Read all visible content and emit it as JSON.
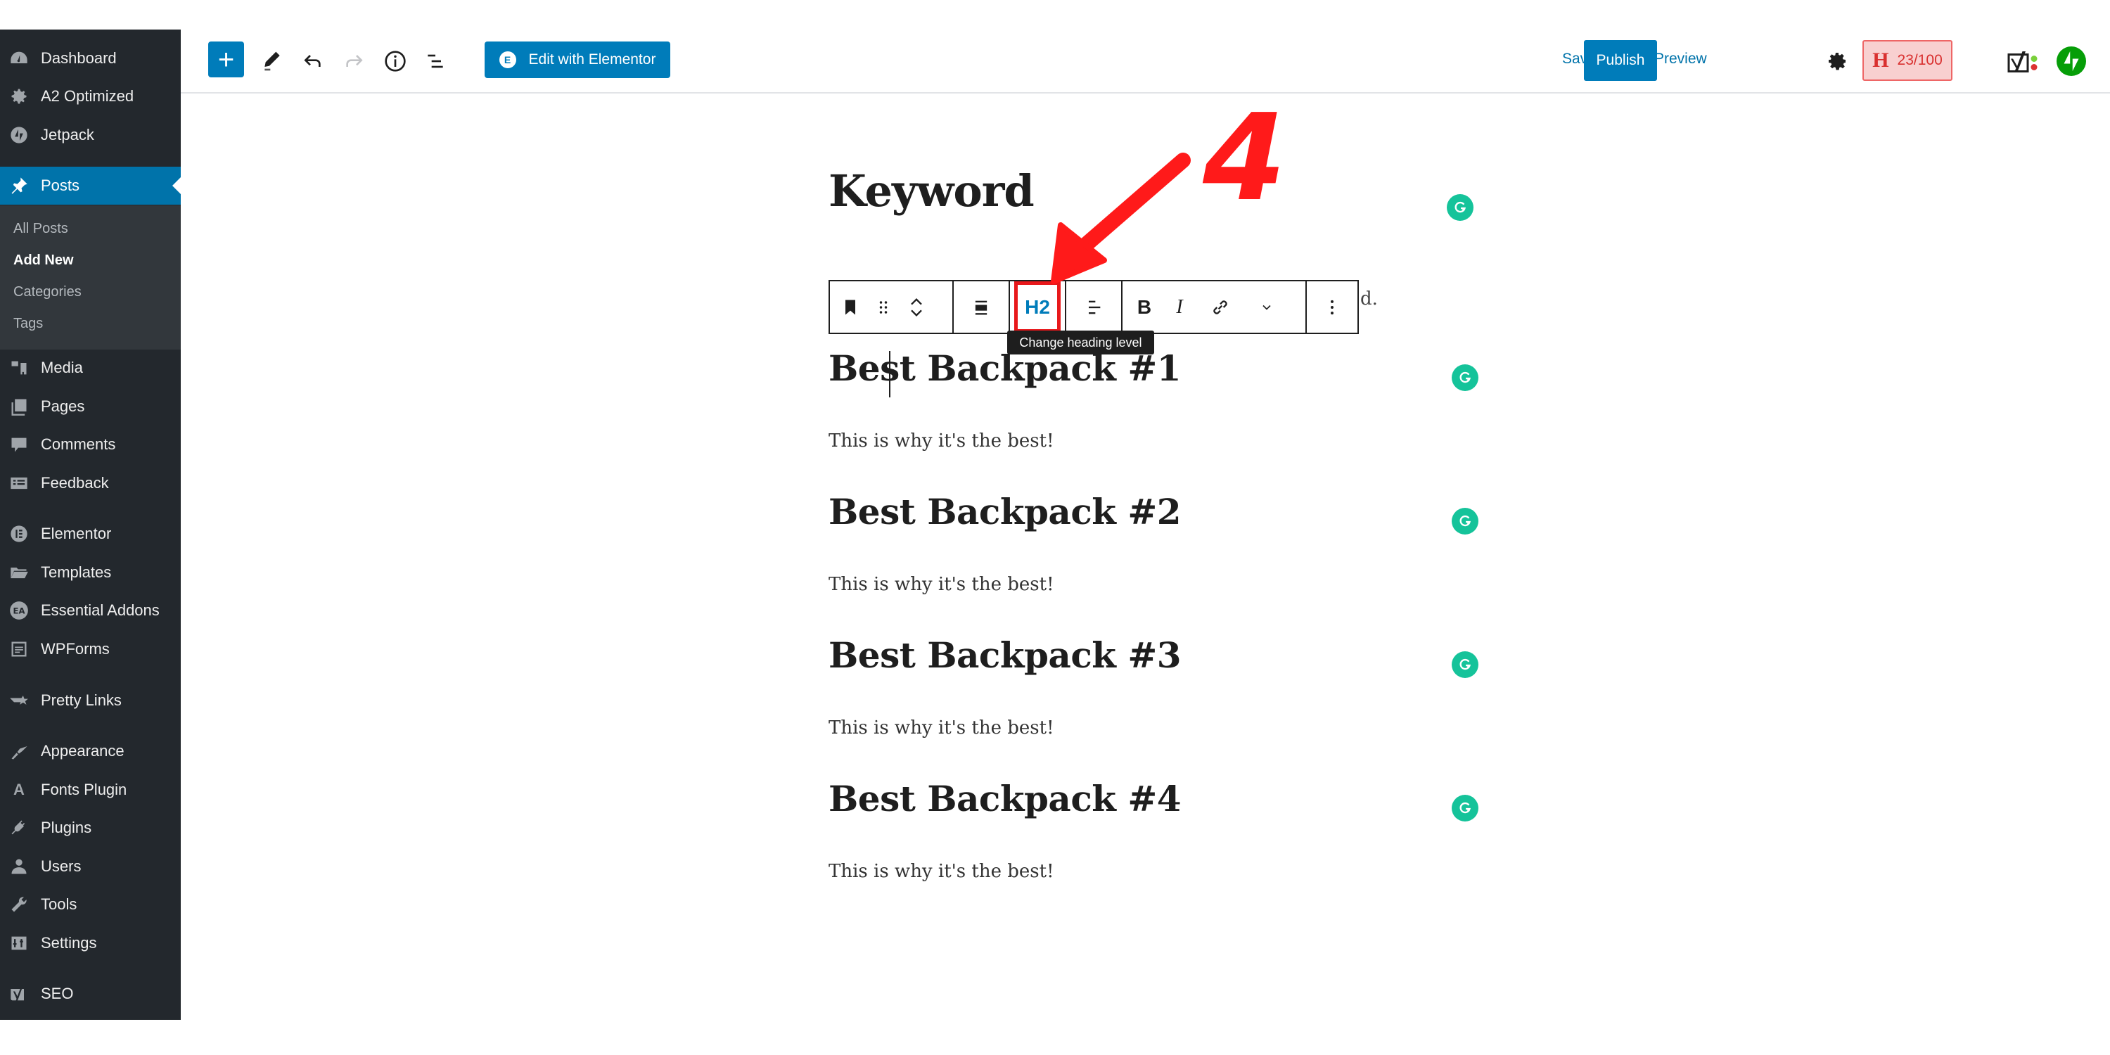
{
  "sidebar": {
    "items": [
      {
        "label": "Dashboard",
        "icon": "dashboard-icon"
      },
      {
        "label": "A2 Optimized",
        "icon": "gear-icon"
      },
      {
        "label": "Jetpack",
        "icon": "jetpack-icon"
      },
      {
        "label": "Posts",
        "icon": "pin-icon",
        "active": true
      },
      {
        "label": "Media",
        "icon": "media-icon"
      },
      {
        "label": "Pages",
        "icon": "pages-icon"
      },
      {
        "label": "Comments",
        "icon": "comment-icon"
      },
      {
        "label": "Feedback",
        "icon": "feedback-icon"
      },
      {
        "label": "Elementor",
        "icon": "elementor-icon"
      },
      {
        "label": "Templates",
        "icon": "folder-icon"
      },
      {
        "label": "Essential Addons",
        "icon": "essential-addons-icon"
      },
      {
        "label": "WPForms",
        "icon": "form-icon"
      },
      {
        "label": "Pretty Links",
        "icon": "pretty-links-icon"
      },
      {
        "label": "Appearance",
        "icon": "brush-icon"
      },
      {
        "label": "Fonts Plugin",
        "icon": "font-icon"
      },
      {
        "label": "Plugins",
        "icon": "plug-icon"
      },
      {
        "label": "Users",
        "icon": "user-icon"
      },
      {
        "label": "Tools",
        "icon": "wrench-icon"
      },
      {
        "label": "Settings",
        "icon": "settings-icon"
      },
      {
        "label": "SEO",
        "icon": "yoast-icon"
      }
    ],
    "submenu": [
      {
        "label": "All Posts"
      },
      {
        "label": "Add New",
        "current": true
      },
      {
        "label": "Categories"
      },
      {
        "label": "Tags"
      }
    ]
  },
  "header": {
    "add_block_symbol": "+",
    "edit_with_elementor": "Edit with Elementor",
    "elementor_badge": "E",
    "save_draft": "Save draft",
    "preview": "Preview",
    "publish": "Publish",
    "seo_badge_letter": "H",
    "seo_score": "23/100"
  },
  "editor": {
    "title": "Keyword",
    "hidden_text_fragment": "d.",
    "toolbar": {
      "heading_level": "H2",
      "tooltip": "Change heading level",
      "bold": "B",
      "italic": "I"
    },
    "blocks": [
      {
        "heading": "Best Backpack #1",
        "paragraph": "This is why it's the best!"
      },
      {
        "heading": "Best Backpack #2",
        "paragraph": "This is why it's the best!"
      },
      {
        "heading": "Best Backpack #3",
        "paragraph": "This is why it's the best!"
      },
      {
        "heading": "Best Backpack #4",
        "paragraph": "This is why it's the best!"
      }
    ]
  },
  "annotation": {
    "step_number": "4",
    "color": "#ff1a1a"
  },
  "colors": {
    "wp_blue": "#007cba",
    "sidebar_bg": "#23282d",
    "grammarly_green": "#15c39a",
    "jetpack_green": "#069e08"
  }
}
